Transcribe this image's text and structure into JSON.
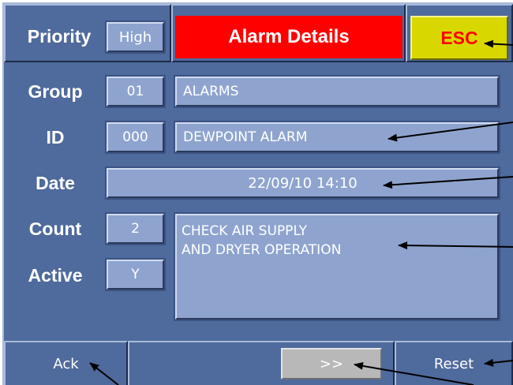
{
  "header": {
    "priority_label": "Priority",
    "priority_value": "High",
    "title": "Alarm Details",
    "esc_label": "ESC"
  },
  "fields": {
    "group_label": "Group",
    "group_code": "01",
    "group_name": "ALARMS",
    "id_label": "ID",
    "id_code": "000",
    "id_name": "DEWPOINT ALARM",
    "date_label": "Date",
    "date_value": "22/09/10  14:10",
    "count_label": "Count",
    "count_value": "2",
    "active_label": "Active",
    "active_value": "Y",
    "message": "CHECK AIR SUPPLY\nAND DRYER OPERATION"
  },
  "footer": {
    "ack_label": "Ack",
    "next_label": ">>",
    "reset_label": "Reset"
  },
  "colors": {
    "panel_bg": "#4f6a9c",
    "field_bg": "#8ea4cf",
    "title_bg": "#ff0000",
    "esc_bg": "#d8d800",
    "esc_text": "#ff0000",
    "next_bg": "#b8b8b8"
  }
}
